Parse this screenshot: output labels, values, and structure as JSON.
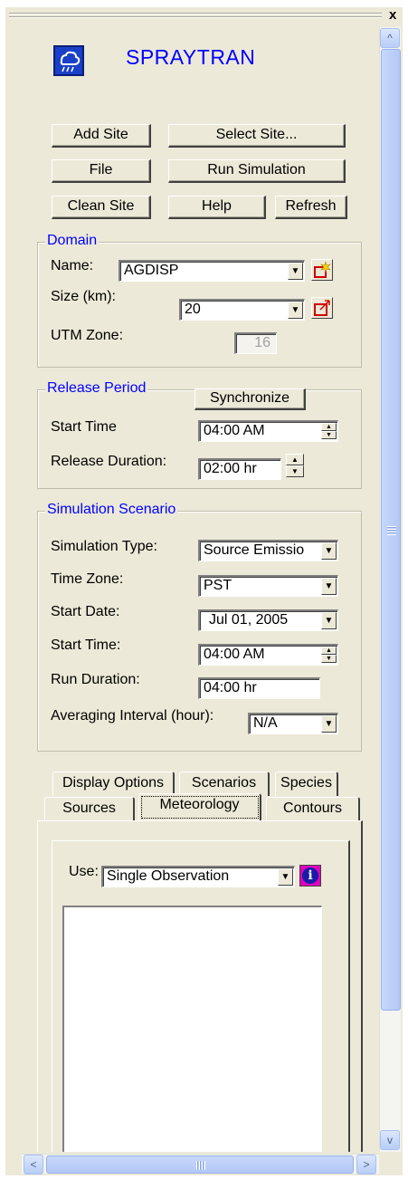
{
  "app": {
    "title": "SPRAYTRAN",
    "close_glyph": "x"
  },
  "buttons": {
    "add_site": "Add Site",
    "select_site": "Select Site...",
    "file": "File",
    "run_simulation": "Run Simulation",
    "clean_site": "Clean Site",
    "help": "Help",
    "refresh": "Refresh"
  },
  "domain": {
    "legend": "Domain",
    "name_label": "Name:",
    "name_value": "AGDISP",
    "size_label": "Size (km):",
    "size_value": "20",
    "utm_label": "UTM Zone:",
    "utm_value": "16"
  },
  "release": {
    "legend": "Release Period",
    "synchronize": "Synchronize",
    "start_time_label": "Start Time",
    "start_time_value": "04:00 AM",
    "duration_label": "Release Duration:",
    "duration_value": "02:00 hr"
  },
  "scenario": {
    "legend": "Simulation Scenario",
    "type_label": "Simulation Type:",
    "type_value": "Source Emissio",
    "timezone_label": "Time Zone:",
    "timezone_value": "PST",
    "start_date_label": "Start Date:",
    "start_date_value": "Jul 01, 2005",
    "start_time_label": "Start Time:",
    "start_time_value": "04:00 AM",
    "run_duration_label": "Run Duration:",
    "run_duration_value": "04:00 hr",
    "averaging_label": "Averaging Interval (hour):",
    "averaging_value": "N/A"
  },
  "tabs": {
    "row1": [
      "Display Options",
      "Scenarios",
      "Species"
    ],
    "row2": [
      "Sources",
      "Meteorology",
      "Contours"
    ],
    "active": "Meteorology"
  },
  "meteorology": {
    "use_label": "Use:",
    "use_value": "Single Observation"
  },
  "icons": {
    "dropdown": "▼",
    "up": "▲",
    "down": "▼",
    "scroll_up": "^",
    "scroll_down": "v",
    "scroll_left": "<",
    "scroll_right": ">",
    "info": "i"
  }
}
